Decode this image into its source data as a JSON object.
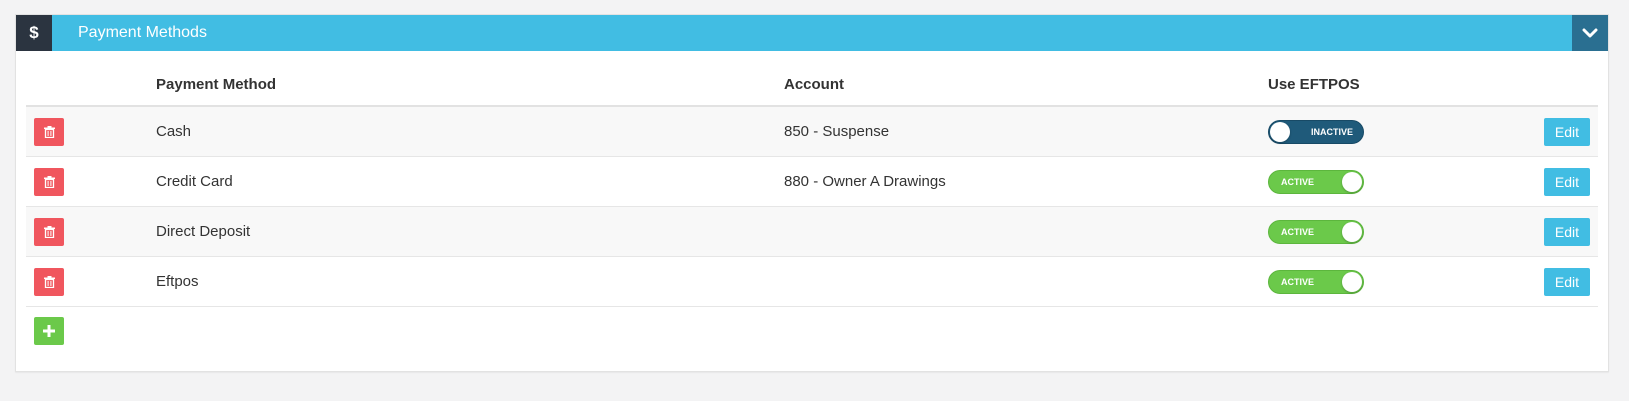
{
  "panel": {
    "icon": "dollar-icon",
    "icon_glyph": "$",
    "title": "Payment Methods",
    "collapse_icon": "chevron-down-icon"
  },
  "table": {
    "headers": {
      "method": "Payment Method",
      "account": "Account",
      "eftpos": "Use EFTPOS"
    },
    "rows": [
      {
        "method": "Cash",
        "account": "850 - Suspense",
        "eftpos_state": "off",
        "eftpos_label": "INACTIVE",
        "edit_label": "Edit"
      },
      {
        "method": "Credit Card",
        "account": "880 - Owner A Drawings",
        "eftpos_state": "on",
        "eftpos_label": "ACTIVE",
        "edit_label": "Edit"
      },
      {
        "method": "Direct Deposit",
        "account": "",
        "eftpos_state": "on",
        "eftpos_label": "ACTIVE",
        "edit_label": "Edit"
      },
      {
        "method": "Eftpos",
        "account": "",
        "eftpos_state": "on",
        "eftpos_label": "ACTIVE",
        "edit_label": "Edit"
      }
    ]
  },
  "actions": {
    "delete_icon": "trash-icon",
    "add_icon": "plus-icon"
  },
  "colors": {
    "header_bg": "#41bde3",
    "icon_bg": "#2b3440",
    "collapse_bg": "#2a6f91",
    "delete_bg": "#f0565e",
    "add_bg": "#6bc94a",
    "toggle_on": "#6bc94a",
    "toggle_off": "#1f5a7a",
    "edit_bg": "#41bde3"
  }
}
